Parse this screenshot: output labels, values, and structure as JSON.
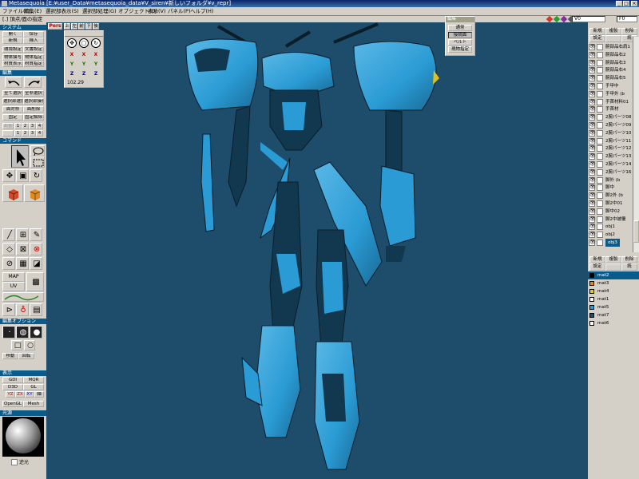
{
  "window": {
    "title": "Metasequoia [E:¥user_Data¥metasequoia_data¥V_siren¥新しいフォルダ¥v_repr]",
    "buttons": [
      "_",
      "□",
      "×"
    ]
  },
  "menu": [
    "ファイル(F)",
    "編集(E)",
    "選択部表示(S)",
    "選択部処理(G)",
    "オブジェクト(O)",
    "表示(V)",
    "パネル(P)",
    "ヘルプ(H)"
  ],
  "status_bar": {
    "text": "[.] 頂点/面の指定",
    "v_label": "V0",
    "f_label": "F0"
  },
  "colors": {
    "viewport_bg": "#1e4d6b",
    "section_header": "#0a5a8a",
    "model_primary": "#2a9bd4",
    "model_light": "#5ab8e6",
    "model_dark": "#12384f",
    "accent_red": "#d43a2a",
    "accent_green": "#2aa02a",
    "accent_purple": "#8a2aa0"
  },
  "left_panel": {
    "system": {
      "header": "システム",
      "buttons": [
        "開く",
        "保存",
        "新規",
        "挿入",
        "環境設定",
        "文書設定",
        "物体描写",
        "物体指定",
        "材質表示",
        "材質指定"
      ]
    },
    "edit": {
      "header": "編集",
      "buttons": [
        "全て選択",
        "全非選択",
        "選択部選択",
        "選択部操作",
        "面対称",
        "面削除",
        "固定",
        "固定解除"
      ],
      "num_row_label": "面番",
      "num_buttons": [
        "1",
        "2",
        "3",
        "4"
      ],
      "num_row_label2": "",
      "num_buttons2": [
        "1",
        "2",
        "3",
        "4"
      ]
    },
    "command": {
      "header": "コマンド",
      "labels": [
        "MAP",
        "UV"
      ]
    },
    "edit_option": {
      "header": "編集オプション",
      "buttons": [
        "移動",
        "回転"
      ]
    },
    "display": {
      "header": "表示",
      "buttons": [
        "GDI",
        "MQR",
        "D3D",
        "GL",
        "OpenGL",
        "Mesh"
      ],
      "axis_buttons": [
        "YZ",
        "ZX",
        "XY",
        "軸"
      ]
    },
    "light": {
      "header": "光源",
      "checkbox_label": "逆光"
    }
  },
  "viewport": {
    "persp_label": "Pers",
    "view_tabs": [
      "上",
      "左",
      "前",
      "下",
      "後"
    ],
    "view_control": {
      "axes": [
        "X",
        "X",
        "X",
        "Y",
        "Y",
        "Y",
        "Z",
        "Z",
        "Z"
      ],
      "zoom": "102.29"
    }
  },
  "mode_popup": {
    "caption": "編集",
    "buttons": [
      "通常",
      "接続面",
      "ベルト",
      "現物指定"
    ],
    "selected_index": 0
  },
  "object_panel": {
    "buttons": [
      "新規",
      "複製",
      "削除",
      "設定",
      "",
      "統"
    ],
    "objects": [
      "腕部品右肩1",
      "腕部品右2",
      "腕部品右3",
      "腕部品右4",
      "腕部品右5",
      "手甲中",
      "手甲外 (b",
      "手首材料01",
      "手首材",
      "2腕パーツ08",
      "2腕パーツ09",
      "2腕パーツ10",
      "2腕パーツ11",
      "2腕パーツ12",
      "2腕パーツ13",
      "2腕パーツ14",
      "2腕パーツ16",
      "脚外 (b",
      "脚中",
      "脚2外 (b",
      "脚2中01",
      "脚中02",
      "脚2中被覆",
      "obj1",
      "obj2",
      "obj3"
    ],
    "selected_index": 25
  },
  "material_panel": {
    "buttons": [
      "新規",
      "複製",
      "削除",
      "設定",
      "",
      "統"
    ],
    "materials": [
      {
        "name": "mat2",
        "color": "#000000"
      },
      {
        "name": "mat3",
        "color": "#e08a10"
      },
      {
        "name": "mat4",
        "color": "#e0d010"
      },
      {
        "name": "mat1",
        "color": "#ffffff"
      },
      {
        "name": "mat5",
        "color": "#2a9bd4"
      },
      {
        "name": "mat7",
        "color": "#1e4d6b"
      },
      {
        "name": "mat6",
        "color": "#ffffff"
      }
    ],
    "selected_index": 0
  }
}
